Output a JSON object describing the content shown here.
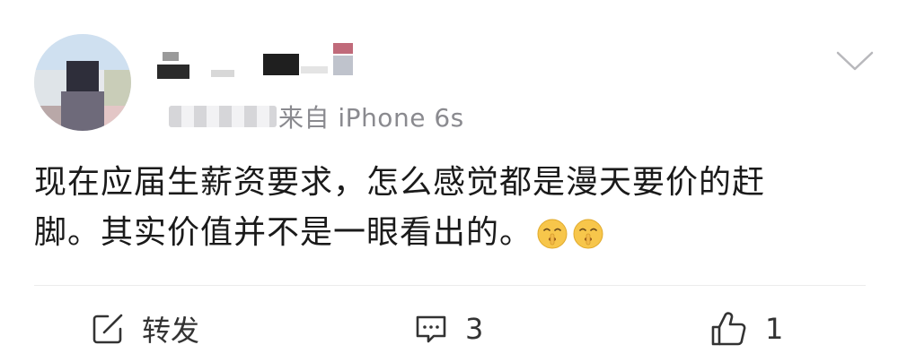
{
  "post": {
    "source": "来自 iPhone 6s",
    "text_line1": "现在应届生薪资要求，怎么感觉都是漫天要价的赶",
    "text_line2": "脚。其实价值并不是一眼看出的。",
    "emojis": [
      "shush-face-emoji",
      "shush-face-emoji"
    ]
  },
  "actions": {
    "repost_label": "转发",
    "comment_count": "3",
    "like_count": "1"
  },
  "icons": {
    "more": "chevron-down-icon",
    "repost": "repost-icon",
    "comment": "comment-icon",
    "like": "thumbs-up-icon"
  },
  "colors": {
    "text": "#1a1a1a",
    "meta": "#8a8a8f",
    "icon": "#333333",
    "divider": "#ececec",
    "emoji_face": "#f7c64b"
  }
}
